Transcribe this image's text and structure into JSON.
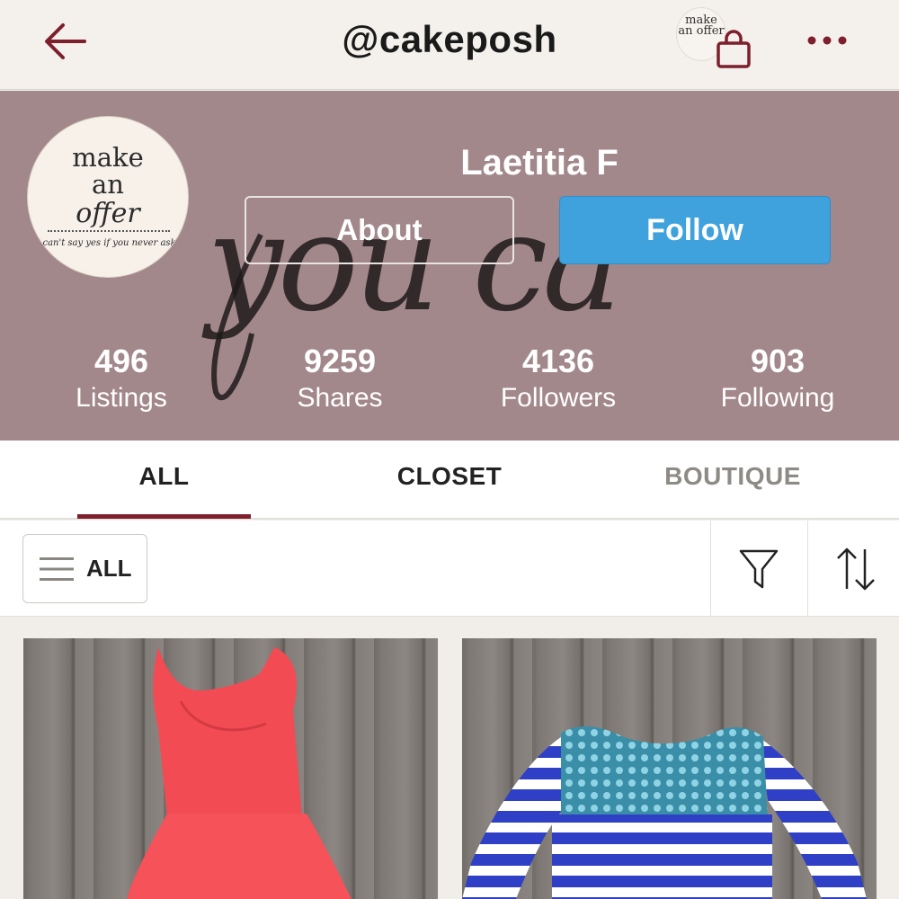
{
  "nav": {
    "title": "@cakeposh",
    "shop_avatar_text": "make an offer"
  },
  "profile": {
    "name": "Laetitia F",
    "avatar": {
      "line1": "make",
      "line2": "an",
      "line3": "offer",
      "tagline": "I can't say yes if you never ask!"
    },
    "cover_script": "you ca",
    "about_label": "About",
    "follow_label": "Follow",
    "stats": [
      {
        "value": "496",
        "label": "Listings"
      },
      {
        "value": "9259",
        "label": "Shares"
      },
      {
        "value": "4136",
        "label": "Followers"
      },
      {
        "value": "903",
        "label": "Following"
      }
    ]
  },
  "tabs": [
    {
      "label": "ALL",
      "active": true
    },
    {
      "label": "CLOSET",
      "active": false
    },
    {
      "label": "BOUTIQUE",
      "active": false
    }
  ],
  "filter": {
    "category_label": "ALL"
  },
  "listings": [
    {
      "item": "coral scalloped dress",
      "color": "#f24b54"
    },
    {
      "item": "blue striped top",
      "color": "#2f3fc6"
    }
  ],
  "colors": {
    "accent": "#7d1f2c",
    "follow_blue": "#3fa2dc",
    "cover": "#a2878b"
  }
}
